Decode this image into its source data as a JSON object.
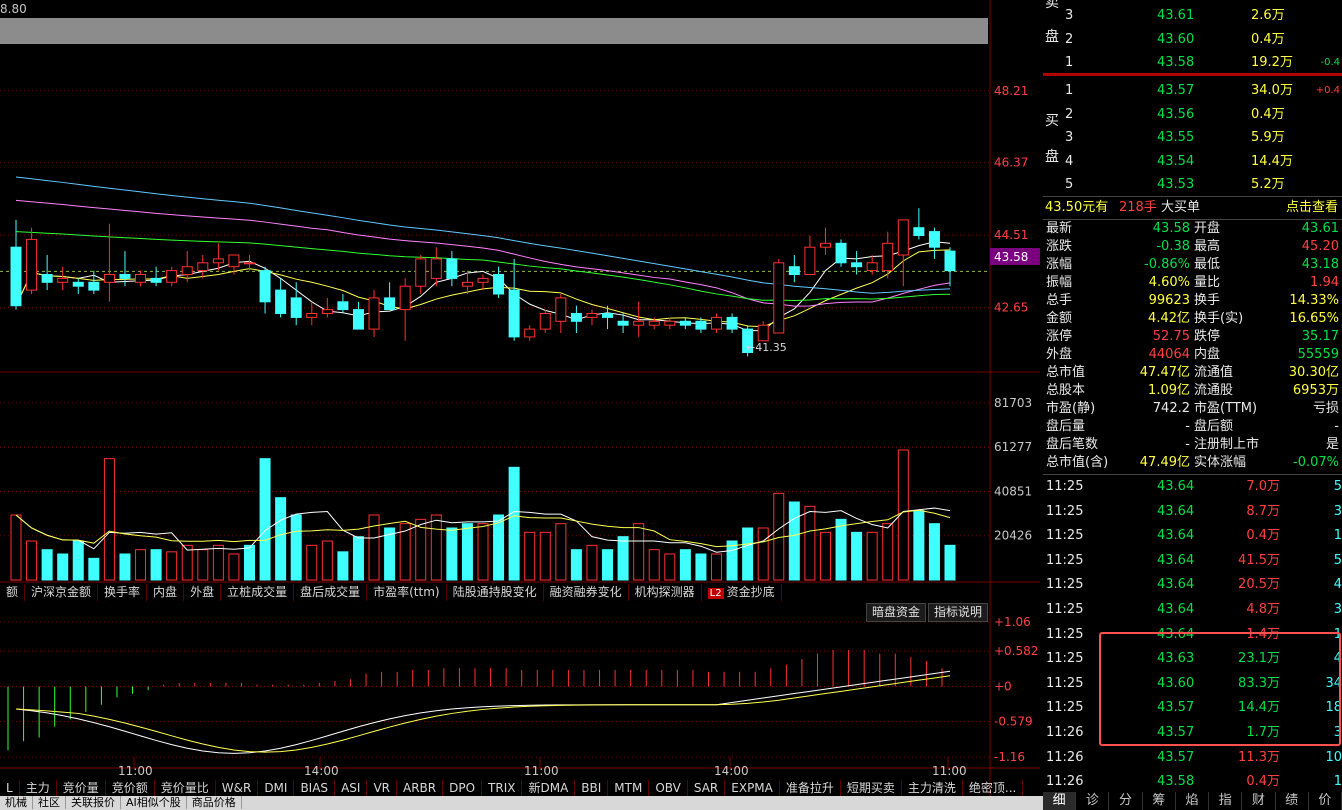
{
  "chart_header": {
    "value": "8.80"
  },
  "price_axis": {
    "labels": [
      "48.21",
      "46.37",
      "44.51",
      "42.65"
    ],
    "current": "43.58"
  },
  "low_marker": "←41.35",
  "volume_axis": {
    "labels": [
      "81703",
      "61277",
      "40851",
      "20426"
    ]
  },
  "macd_axis": {
    "labels": [
      "+1.06",
      "+0.582",
      "+0",
      "-0.579",
      "-1.16"
    ]
  },
  "time_axis": {
    "labels": [
      "11:00",
      "14:00",
      "11:00",
      "14:00",
      "11:00"
    ]
  },
  "indicator_tabs": [
    "额",
    "沪深京金额",
    "换手率",
    "内盘",
    "外盘",
    "立桩成交量",
    "盘后成交量",
    "市盈率(ttm)",
    "陆股通持股变化",
    "融资融券变化",
    "机构探测器"
  ],
  "l2_tab": {
    "badge": "L2",
    "label": "资金抄底"
  },
  "buttons": {
    "dark_pool": "暗盘资金",
    "explain": "指标说明"
  },
  "bottom_tabs": [
    "L",
    "主力",
    "竞价量",
    "竞价额",
    "竞价量比",
    "W&R",
    "DMI",
    "BIAS",
    "ASI",
    "VR",
    "ARBR",
    "DPO",
    "TRIX",
    "新DMA",
    "BBI",
    "MTM",
    "OBV",
    "SAR",
    "EXPMA",
    "准备拉升",
    "短期买卖",
    "主力清洗",
    "绝密顶..."
  ],
  "footer_tabs": [
    "机械",
    "社区",
    "关联报价",
    "AI相似个股",
    "商品价格"
  ],
  "sell_label": [
    "卖",
    "盘"
  ],
  "sell_orders": [
    {
      "level": "3",
      "price": "43.61",
      "vol": "2.6万",
      "chg": ""
    },
    {
      "level": "2",
      "price": "43.60",
      "vol": "0.4万",
      "chg": ""
    },
    {
      "level": "1",
      "price": "43.58",
      "vol": "19.2万",
      "chg": "-0.4"
    }
  ],
  "buy_label": [
    "买",
    "盘"
  ],
  "buy_orders": [
    {
      "level": "1",
      "price": "43.57",
      "vol": "34.0万",
      "chg": "+0.4"
    },
    {
      "level": "2",
      "price": "43.56",
      "vol": "0.4万",
      "chg": ""
    },
    {
      "level": "3",
      "price": "43.55",
      "vol": "5.9万",
      "chg": ""
    },
    {
      "level": "4",
      "price": "43.54",
      "vol": "14.4万",
      "chg": ""
    },
    {
      "level": "5",
      "price": "43.53",
      "vol": "5.2万",
      "chg": ""
    }
  ],
  "big_order": {
    "price": "43.50元有",
    "qty": "218手",
    "text": "大买单",
    "link": "点击查看"
  },
  "stats": [
    {
      "l1": "最新",
      "v1": "43.58",
      "c1": "g",
      "l2": "开盘",
      "v2": "43.61",
      "c2": "g"
    },
    {
      "l1": "涨跌",
      "v1": "-0.38",
      "c1": "g",
      "l2": "最高",
      "v2": "45.20",
      "c2": "r"
    },
    {
      "l1": "涨幅",
      "v1": "-0.86%",
      "c1": "g",
      "l2": "最低",
      "v2": "43.18",
      "c2": "g"
    },
    {
      "l1": "振幅",
      "v1": "4.60%",
      "c1": "y",
      "l2": "量比",
      "v2": "1.94",
      "c2": "r"
    },
    {
      "l1": "总手",
      "v1": "99623",
      "c1": "y",
      "l2": "换手",
      "v2": "14.33%",
      "c2": "y"
    },
    {
      "l1": "金额",
      "v1": "4.42亿",
      "c1": "y",
      "l2": "换手(实)",
      "v2": "16.65%",
      "c2": "y"
    },
    {
      "l1": "涨停",
      "v1": "52.75",
      "c1": "r",
      "l2": "跌停",
      "v2": "35.17",
      "c2": "g"
    },
    {
      "l1": "外盘",
      "v1": "44064",
      "c1": "r",
      "l2": "内盘",
      "v2": "55559",
      "c2": "g"
    },
    {
      "l1": "总市值",
      "v1": "47.47亿",
      "c1": "y",
      "l2": "流通值",
      "v2": "30.30亿",
      "c2": "y"
    },
    {
      "l1": "总股本",
      "v1": "1.09亿",
      "c1": "y",
      "l2": "流通股",
      "v2": "6953万",
      "c2": "y"
    },
    {
      "l1": "市盈(静)",
      "v1": "742.2",
      "c1": "w",
      "l2": "市盈(TTM)",
      "v2": "亏损",
      "c2": "w"
    },
    {
      "l1": "盘后量",
      "v1": "-",
      "c1": "w",
      "l2": "盘后额",
      "v2": "-",
      "c2": "w"
    },
    {
      "l1": "盘后笔数",
      "v1": "-",
      "c1": "w",
      "l2": "注册制上市",
      "v2": "是",
      "c2": "w"
    },
    {
      "l1": "总市值(含)",
      "v1": "47.49亿",
      "c1": "y",
      "l2": "实体涨幅",
      "v2": "-0.07%",
      "c2": "g"
    }
  ],
  "trades": [
    {
      "time": "11:25",
      "price": "43.64",
      "vol": "7.0万",
      "vc": "r",
      "n": "5"
    },
    {
      "time": "11:25",
      "price": "43.64",
      "vol": "8.7万",
      "vc": "r",
      "n": "3"
    },
    {
      "time": "11:25",
      "price": "43.64",
      "vol": "0.4万",
      "vc": "r",
      "n": "1"
    },
    {
      "time": "11:25",
      "price": "43.64",
      "vol": "41.5万",
      "vc": "r",
      "n": "5"
    },
    {
      "time": "11:25",
      "price": "43.64",
      "vol": "20.5万",
      "vc": "r",
      "n": "4"
    },
    {
      "time": "11:25",
      "price": "43.64",
      "vol": "4.8万",
      "vc": "r",
      "n": "3"
    },
    {
      "time": "11:25",
      "price": "43.64",
      "vol": "1.4万",
      "vc": "r",
      "n": "1"
    },
    {
      "time": "11:25",
      "price": "43.63",
      "vol": "23.1万",
      "vc": "g",
      "n": "4"
    },
    {
      "time": "11:25",
      "price": "43.60",
      "vol": "83.3万",
      "vc": "g",
      "n": "34"
    },
    {
      "time": "11:25",
      "price": "43.57",
      "vol": "14.4万",
      "vc": "g",
      "n": "18"
    },
    {
      "time": "11:26",
      "price": "43.57",
      "vol": "1.7万",
      "vc": "g",
      "n": "3"
    },
    {
      "time": "11:26",
      "price": "43.57",
      "vol": "11.3万",
      "vc": "r",
      "n": "10"
    },
    {
      "time": "11:26",
      "price": "43.58",
      "vol": "0.4万",
      "vc": "r",
      "n": "1"
    }
  ],
  "side_tabs": [
    "细",
    "诊",
    "分",
    "筹",
    "焰",
    "指",
    "财",
    "绩",
    "价"
  ],
  "colors": {
    "up": "#ff3030",
    "down": "#40ffff",
    "grid": "#7a0000",
    "ma5": "#ffffff",
    "ma10": "#ffff50",
    "ma20": "#ff80ff",
    "ma30": "#30ff30",
    "ma60": "#60c8ff"
  },
  "chart_data": {
    "type": "candlestick",
    "ylim": [
      41.0,
      49.0
    ],
    "candles": [
      {
        "o": 44.2,
        "h": 44.9,
        "l": 42.6,
        "c": 42.7
      },
      {
        "o": 43.1,
        "h": 44.7,
        "l": 43.0,
        "c": 44.4
      },
      {
        "o": 43.5,
        "h": 44.0,
        "l": 43.1,
        "c": 43.3
      },
      {
        "o": 43.3,
        "h": 43.7,
        "l": 43.1,
        "c": 43.4
      },
      {
        "o": 43.3,
        "h": 43.4,
        "l": 43.0,
        "c": 43.2
      },
      {
        "o": 43.3,
        "h": 43.6,
        "l": 43.0,
        "c": 43.1
      },
      {
        "o": 43.3,
        "h": 44.8,
        "l": 42.8,
        "c": 43.5
      },
      {
        "o": 43.5,
        "h": 44.1,
        "l": 43.2,
        "c": 43.4
      },
      {
        "o": 43.3,
        "h": 43.6,
        "l": 43.2,
        "c": 43.5
      },
      {
        "o": 43.4,
        "h": 43.7,
        "l": 43.2,
        "c": 43.3
      },
      {
        "o": 43.3,
        "h": 43.7,
        "l": 43.2,
        "c": 43.6
      },
      {
        "o": 43.5,
        "h": 44.1,
        "l": 43.3,
        "c": 43.7
      },
      {
        "o": 43.6,
        "h": 44.0,
        "l": 43.4,
        "c": 43.8
      },
      {
        "o": 43.8,
        "h": 44.3,
        "l": 43.6,
        "c": 43.9
      },
      {
        "o": 43.7,
        "h": 44.0,
        "l": 43.5,
        "c": 44.0
      },
      {
        "o": 43.8,
        "h": 44.0,
        "l": 43.6,
        "c": 43.8
      },
      {
        "o": 43.6,
        "h": 43.7,
        "l": 42.5,
        "c": 42.8
      },
      {
        "o": 43.1,
        "h": 43.4,
        "l": 42.4,
        "c": 42.5
      },
      {
        "o": 42.9,
        "h": 43.3,
        "l": 42.2,
        "c": 42.4
      },
      {
        "o": 42.4,
        "h": 42.8,
        "l": 42.2,
        "c": 42.5
      },
      {
        "o": 42.5,
        "h": 42.9,
        "l": 42.4,
        "c": 42.6
      },
      {
        "o": 42.8,
        "h": 43.0,
        "l": 42.5,
        "c": 42.6
      },
      {
        "o": 42.6,
        "h": 42.8,
        "l": 42.1,
        "c": 42.1
      },
      {
        "o": 42.1,
        "h": 43.1,
        "l": 41.9,
        "c": 42.9
      },
      {
        "o": 42.9,
        "h": 43.3,
        "l": 42.7,
        "c": 42.6
      },
      {
        "o": 42.6,
        "h": 43.4,
        "l": 41.8,
        "c": 43.2
      },
      {
        "o": 43.2,
        "h": 44.0,
        "l": 43.0,
        "c": 43.9
      },
      {
        "o": 43.4,
        "h": 44.2,
        "l": 43.2,
        "c": 43.9
      },
      {
        "o": 43.9,
        "h": 44.1,
        "l": 43.2,
        "c": 43.4
      },
      {
        "o": 43.2,
        "h": 43.6,
        "l": 43.0,
        "c": 43.3
      },
      {
        "o": 43.3,
        "h": 43.5,
        "l": 43.1,
        "c": 43.4
      },
      {
        "o": 43.5,
        "h": 43.7,
        "l": 42.9,
        "c": 43.0
      },
      {
        "o": 43.1,
        "h": 43.9,
        "l": 41.8,
        "c": 41.9
      },
      {
        "o": 41.9,
        "h": 42.2,
        "l": 41.8,
        "c": 42.1
      },
      {
        "o": 42.1,
        "h": 42.6,
        "l": 42.0,
        "c": 42.5
      },
      {
        "o": 42.3,
        "h": 43.0,
        "l": 42.0,
        "c": 42.9
      },
      {
        "o": 42.5,
        "h": 42.7,
        "l": 42.0,
        "c": 42.3
      },
      {
        "o": 42.4,
        "h": 42.6,
        "l": 42.2,
        "c": 42.5
      },
      {
        "o": 42.5,
        "h": 42.7,
        "l": 42.1,
        "c": 42.4
      },
      {
        "o": 42.3,
        "h": 42.5,
        "l": 42.0,
        "c": 42.2
      },
      {
        "o": 42.2,
        "h": 42.8,
        "l": 41.9,
        "c": 42.3
      },
      {
        "o": 42.2,
        "h": 42.4,
        "l": 42.1,
        "c": 42.3
      },
      {
        "o": 42.2,
        "h": 42.4,
        "l": 42.1,
        "c": 42.3
      },
      {
        "o": 42.3,
        "h": 42.4,
        "l": 42.1,
        "c": 42.2
      },
      {
        "o": 42.3,
        "h": 42.4,
        "l": 42.0,
        "c": 42.1
      },
      {
        "o": 42.1,
        "h": 42.5,
        "l": 42.0,
        "c": 42.4
      },
      {
        "o": 42.4,
        "h": 42.5,
        "l": 42.0,
        "c": 42.1
      },
      {
        "o": 42.1,
        "h": 42.2,
        "l": 41.4,
        "c": 41.5
      },
      {
        "o": 41.8,
        "h": 42.3,
        "l": 41.8,
        "c": 42.2
      },
      {
        "o": 42.0,
        "h": 43.9,
        "l": 42.0,
        "c": 43.8
      },
      {
        "o": 43.7,
        "h": 44.0,
        "l": 43.3,
        "c": 43.5
      },
      {
        "o": 43.5,
        "h": 44.5,
        "l": 43.5,
        "c": 44.2
      },
      {
        "o": 44.2,
        "h": 44.7,
        "l": 44.0,
        "c": 44.3
      },
      {
        "o": 44.3,
        "h": 44.4,
        "l": 43.7,
        "c": 43.8
      },
      {
        "o": 43.8,
        "h": 44.1,
        "l": 43.5,
        "c": 43.7
      },
      {
        "o": 43.6,
        "h": 44.0,
        "l": 43.5,
        "c": 43.8
      },
      {
        "o": 43.6,
        "h": 44.6,
        "l": 43.4,
        "c": 44.3
      },
      {
        "o": 44.0,
        "h": 44.9,
        "l": 43.2,
        "c": 44.9
      },
      {
        "o": 44.7,
        "h": 45.2,
        "l": 44.4,
        "c": 44.5
      },
      {
        "o": 44.6,
        "h": 44.7,
        "l": 43.9,
        "c": 44.2
      },
      {
        "o": 44.1,
        "h": 44.2,
        "l": 43.2,
        "c": 43.6
      }
    ],
    "volumes": [
      30000,
      18000,
      14000,
      12000,
      18000,
      10000,
      56000,
      12000,
      14000,
      14000,
      13000,
      16000,
      14000,
      16000,
      12000,
      16000,
      56000,
      38000,
      30000,
      16000,
      18000,
      13000,
      20000,
      30000,
      24000,
      26000,
      28000,
      30000,
      24000,
      26000,
      26000,
      30000,
      52000,
      22000,
      22000,
      26000,
      14000,
      16000,
      14000,
      20000,
      26000,
      14000,
      12000,
      14000,
      12000,
      12000,
      18000,
      24000,
      24000,
      40000,
      36000,
      34000,
      22000,
      28000,
      22000,
      22000,
      26000,
      60000,
      32000,
      26000,
      16000
    ],
    "volume_up": [
      true,
      true,
      false,
      false,
      false,
      false,
      true,
      false,
      true,
      false,
      true,
      true,
      true,
      true,
      true,
      false,
      false,
      false,
      false,
      true,
      true,
      false,
      false,
      true,
      false,
      true,
      true,
      true,
      false,
      false,
      true,
      false,
      false,
      true,
      true,
      true,
      false,
      true,
      false,
      false,
      true,
      true,
      true,
      false,
      false,
      true,
      false,
      false,
      true,
      true,
      false,
      true,
      true,
      false,
      false,
      true,
      true,
      true,
      false,
      false,
      false
    ],
    "ylim_volume": [
      0,
      90000
    ],
    "macd": [
      -0.35,
      -0.3,
      -0.28,
      -0.22,
      -0.18,
      -0.14,
      -0.1,
      -0.06,
      -0.04,
      -0.02,
      0.01,
      0.02,
      0.02,
      0.02,
      0.02,
      0.02,
      0.01,
      0.01,
      0.01,
      0.01,
      0.02,
      0.03,
      0.04,
      0.07,
      0.08,
      0.08,
      0.09,
      0.09,
      0.1,
      0.1,
      0.1,
      0.1,
      0.1,
      0.09,
      0.09,
      0.09,
      0.09,
      0.09,
      0.09,
      0.09,
      0.09,
      0.09,
      0.09,
      0.09,
      0.09,
      0.08,
      0.08,
      0.08,
      0.08,
      0.1,
      0.12,
      0.15,
      0.18,
      0.2,
      0.2,
      0.2,
      0.18,
      0.18,
      0.16,
      0.14,
      0.1
    ],
    "ylim_macd": [
      -1.16,
      1.06
    ]
  }
}
